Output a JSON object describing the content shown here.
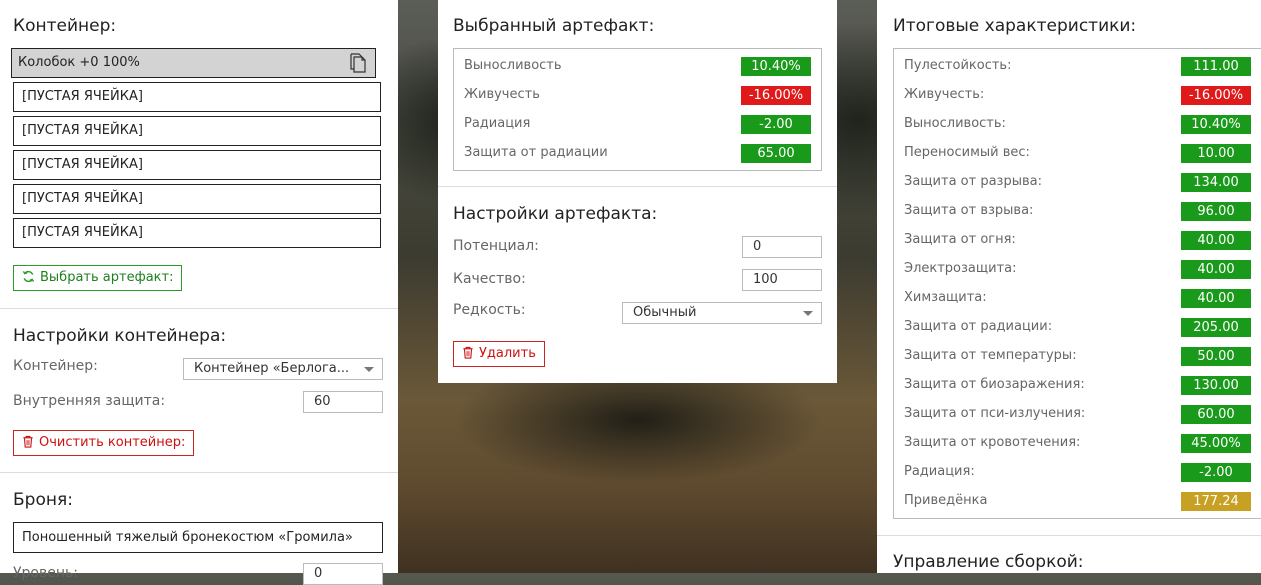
{
  "container_section": {
    "title": "Контейнер:",
    "slots": [
      {
        "label": "Колобок +0 100%",
        "selected": true
      },
      {
        "label": "[ПУСТАЯ ЯЧЕЙКА]"
      },
      {
        "label": "[ПУСТАЯ ЯЧЕЙКА]"
      },
      {
        "label": "[ПУСТАЯ ЯЧЕЙКА]"
      },
      {
        "label": "[ПУСТАЯ ЯЧЕЙКА]"
      },
      {
        "label": "[ПУСТАЯ ЯЧЕЙКА]"
      }
    ],
    "choose_button": "Выбрать артефакт:"
  },
  "container_settings": {
    "title": "Настройки контейнера:",
    "container_label": "Контейнер:",
    "container_value": "Контейнер «Берлога...",
    "inner_protection_label": "Внутренняя защита:",
    "inner_protection_value": "60",
    "clear_button": "Очистить контейнер:"
  },
  "armor": {
    "title": "Броня:",
    "value": "Поношенный тяжелый бронекостюм «Громила»",
    "level_label": "Уровень:",
    "level_value": "0"
  },
  "selected_artifact": {
    "title": "Выбранный артефакт:",
    "stats": [
      {
        "name": "Выносливость",
        "value": "10.40%",
        "color": "green"
      },
      {
        "name": "Живучесть",
        "value": "-16.00%",
        "color": "red"
      },
      {
        "name": "Радиация",
        "value": "-2.00",
        "color": "green"
      },
      {
        "name": "Защита от радиации",
        "value": "65.00",
        "color": "green"
      }
    ]
  },
  "artifact_settings": {
    "title": "Настройки артефакта:",
    "potential_label": "Потенциал:",
    "potential_value": "0",
    "quality_label": "Качество:",
    "quality_value": "100",
    "rarity_label": "Редкость:",
    "rarity_value": "Обычный",
    "delete_button": "Удалить"
  },
  "total_stats": {
    "title": "Итоговые характеристики:",
    "stats": [
      {
        "name": "Пулестойкость:",
        "value": "111.00",
        "color": "green"
      },
      {
        "name": "Живучесть:",
        "value": "-16.00%",
        "color": "red"
      },
      {
        "name": "Выносливость:",
        "value": "10.40%",
        "color": "green"
      },
      {
        "name": "Переносимый вес:",
        "value": "10.00",
        "color": "green"
      },
      {
        "name": "Защита от разрыва:",
        "value": "134.00",
        "color": "green"
      },
      {
        "name": "Защита от взрыва:",
        "value": "96.00",
        "color": "green"
      },
      {
        "name": "Защита от огня:",
        "value": "40.00",
        "color": "green"
      },
      {
        "name": "Электрозащита:",
        "value": "40.00",
        "color": "green"
      },
      {
        "name": "Химзащита:",
        "value": "40.00",
        "color": "green"
      },
      {
        "name": "Защита от радиации:",
        "value": "205.00",
        "color": "green"
      },
      {
        "name": "Защита от температуры:",
        "value": "50.00",
        "color": "green"
      },
      {
        "name": "Защита от биозаражения:",
        "value": "130.00",
        "color": "green"
      },
      {
        "name": "Защита от пси-излучения:",
        "value": "60.00",
        "color": "green"
      },
      {
        "name": "Защита от кровотечения:",
        "value": "45.00%",
        "color": "green"
      },
      {
        "name": "Радиация:",
        "value": "-2.00",
        "color": "green"
      },
      {
        "name": "Приведёнка",
        "value": "177.24",
        "color": "gold"
      }
    ]
  },
  "build_management": {
    "title": "Управление сборкой:"
  },
  "colors": {
    "green": "#1a9a1a",
    "red": "#e01a1a",
    "gold": "#c8a024"
  }
}
